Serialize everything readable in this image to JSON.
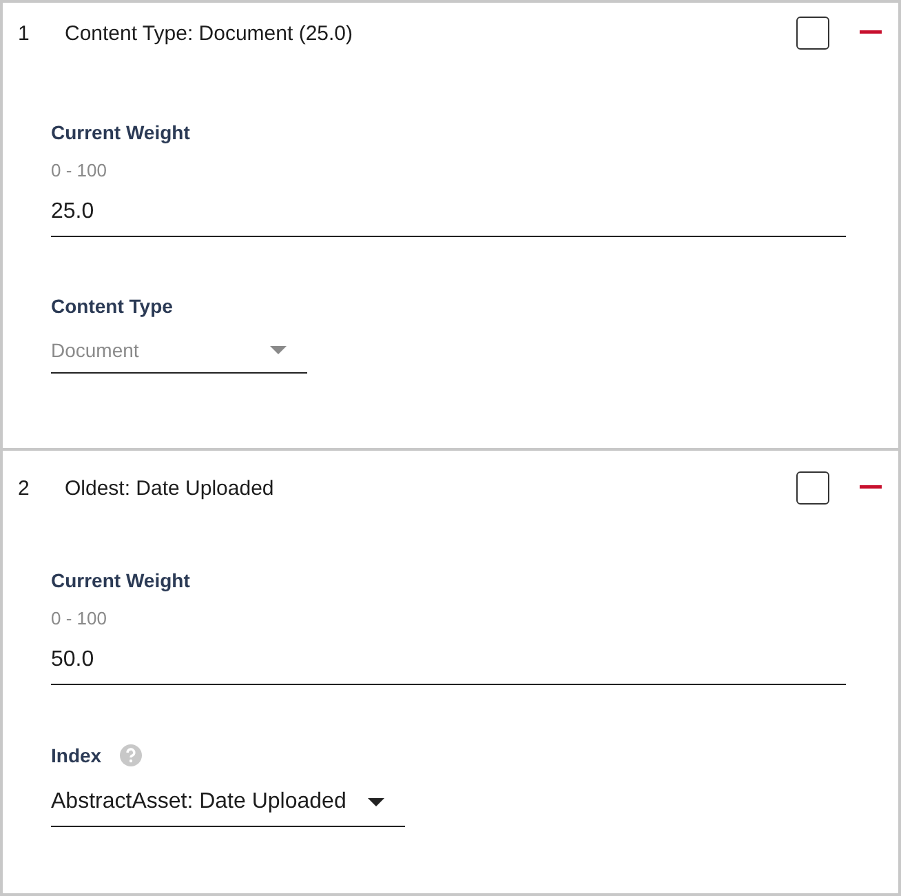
{
  "rules": [
    {
      "number": "1",
      "title": "Content Type: Document (25.0)",
      "checked": false,
      "weight_label": "Current Weight",
      "weight_range": "0 - 100",
      "weight_value": "25.0",
      "select_label": "Content Type",
      "help": false,
      "select_value": "Document",
      "select_disabled": true
    },
    {
      "number": "2",
      "title": "Oldest: Date Uploaded",
      "checked": false,
      "weight_label": "Current Weight",
      "weight_range": "0 - 100",
      "weight_value": "50.0",
      "select_label": "Index",
      "help": true,
      "select_value": "AbstractAsset: Date Uploaded",
      "select_disabled": false
    }
  ]
}
